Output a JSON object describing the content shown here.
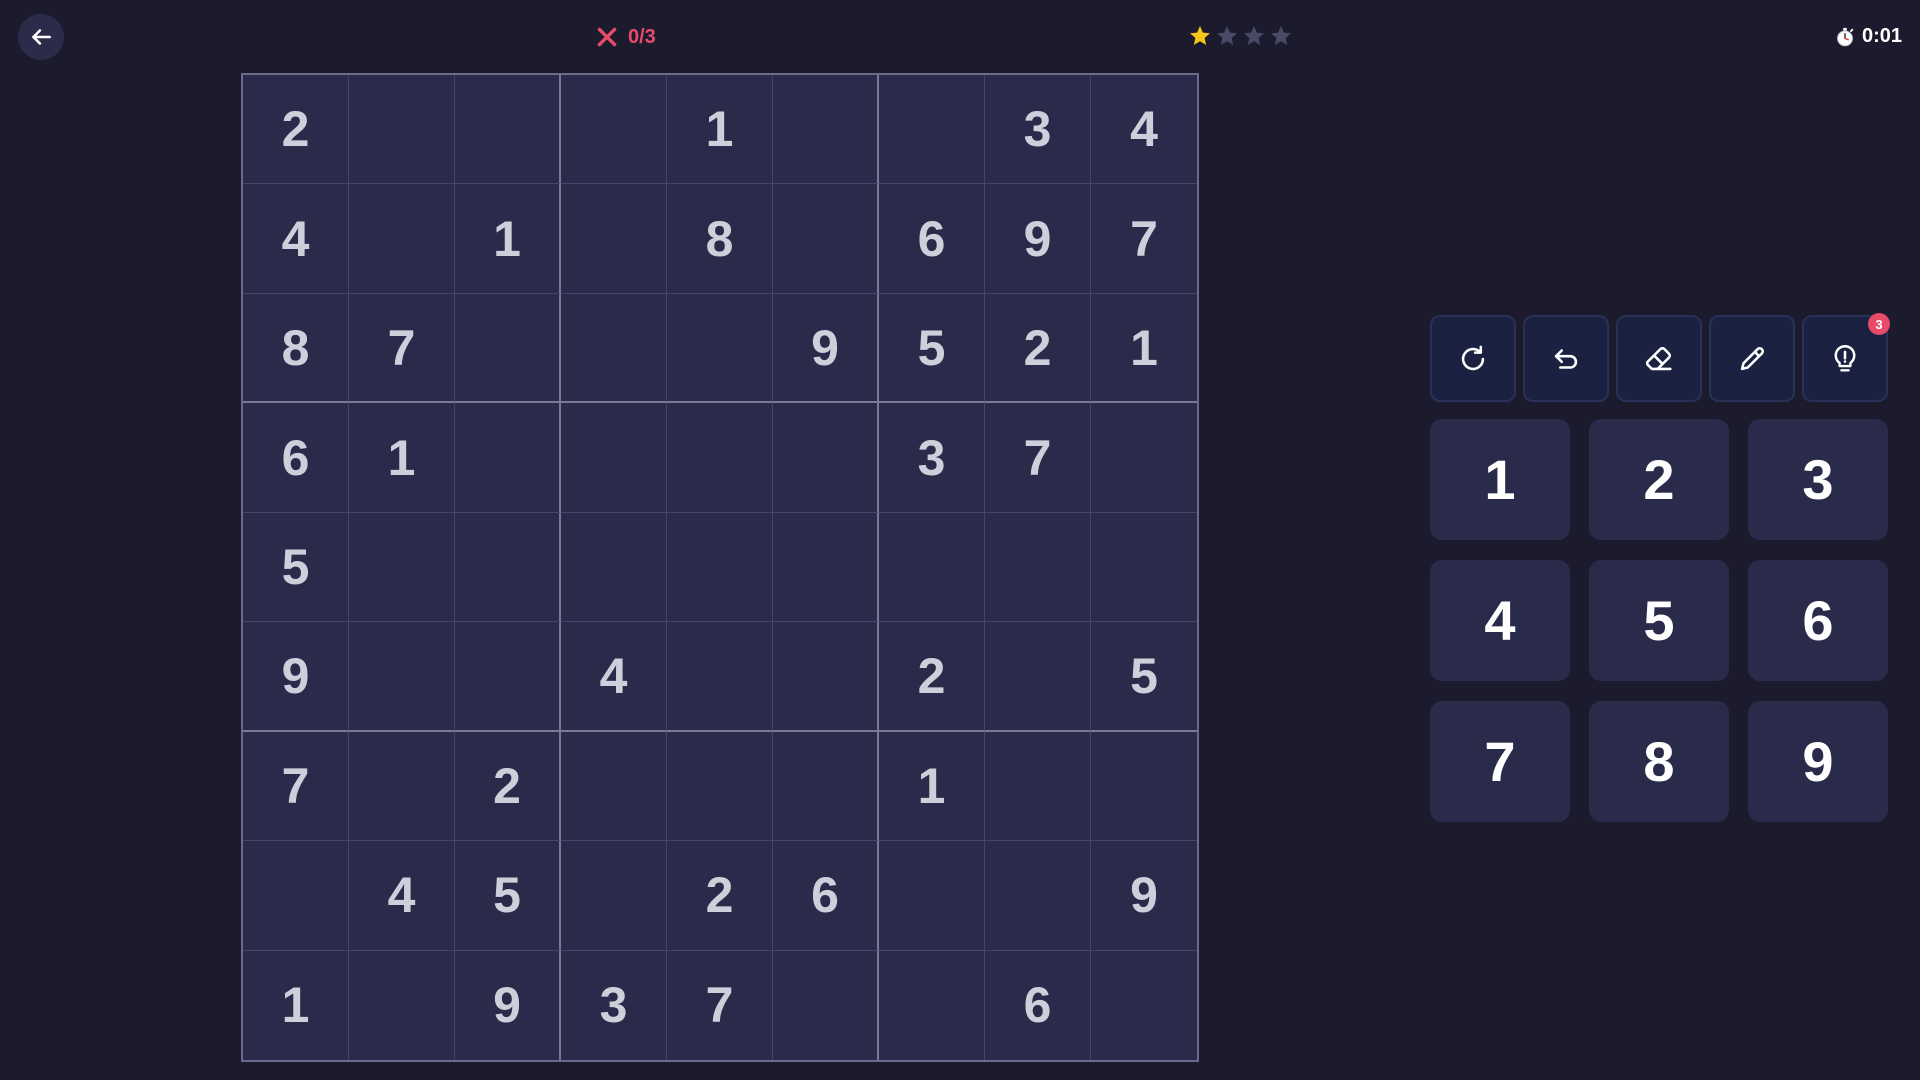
{
  "header": {
    "back_icon": "arrow-left-icon",
    "mistakes_icon": "x-icon",
    "mistakes": "0/3",
    "stars": {
      "filled": 1,
      "total": 4
    },
    "timer_icon": "stopwatch-icon",
    "timer": "0:01"
  },
  "colors": {
    "background": "#1c1b2e",
    "cell": "#2a2a4a",
    "tool": "#1b2140",
    "accent_red": "#e84a6a",
    "star_filled": "#f5c518",
    "star_empty": "#4a4a66"
  },
  "board": {
    "grid": [
      [
        "2",
        "",
        "",
        "",
        "1",
        "",
        "",
        "3",
        "4"
      ],
      [
        "4",
        "",
        "1",
        "",
        "8",
        "",
        "6",
        "9",
        "7"
      ],
      [
        "8",
        "7",
        "",
        "",
        "",
        "9",
        "5",
        "2",
        "1"
      ],
      [
        "6",
        "1",
        "",
        "",
        "",
        "",
        "3",
        "7",
        ""
      ],
      [
        "5",
        "",
        "",
        "",
        "",
        "",
        "",
        "",
        ""
      ],
      [
        "9",
        "",
        "",
        "4",
        "",
        "",
        "2",
        "",
        "5"
      ],
      [
        "7",
        "",
        "2",
        "",
        "",
        "",
        "1",
        "",
        ""
      ],
      [
        "",
        "4",
        "5",
        "",
        "2",
        "6",
        "",
        "",
        "9"
      ],
      [
        "1",
        "",
        "9",
        "3",
        "7",
        "",
        "",
        "6",
        ""
      ]
    ]
  },
  "tools": {
    "items": [
      {
        "name": "restart",
        "icon": "restart-icon"
      },
      {
        "name": "undo",
        "icon": "undo-icon"
      },
      {
        "name": "erase",
        "icon": "eraser-icon"
      },
      {
        "name": "notes",
        "icon": "pencil-icon"
      },
      {
        "name": "hint",
        "icon": "lightbulb-icon",
        "badge": "3"
      }
    ]
  },
  "numpad": {
    "keys": [
      "1",
      "2",
      "3",
      "4",
      "5",
      "6",
      "7",
      "8",
      "9"
    ]
  }
}
